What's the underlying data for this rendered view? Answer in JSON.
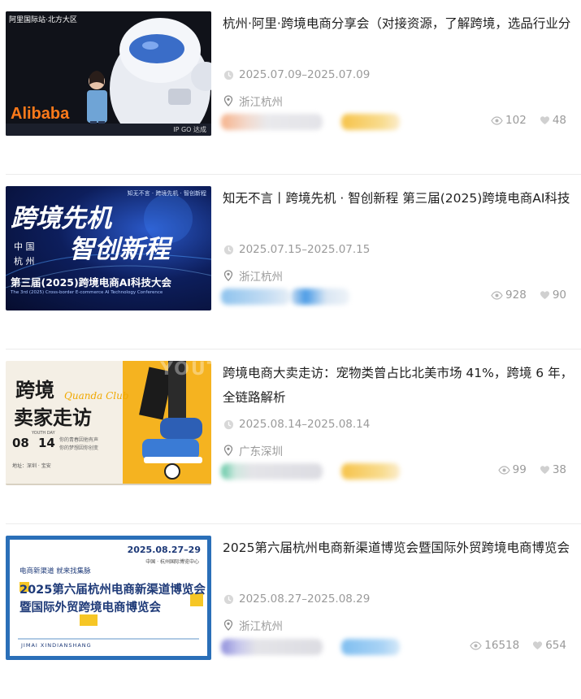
{
  "events": [
    {
      "title": "杭州·阿里·跨境电商分享会（对接资源，了解跨境，选品行业分",
      "date": "2025.07.09–2025.07.09",
      "location": "浙江杭州",
      "views": "102",
      "likes": "48",
      "thumb": {
        "top_text": "阿里国际站·北方大区",
        "brand": "Alibaba",
        "badge": "IP GO 达成"
      },
      "blur_colors": [
        "#f6b38c",
        "#f6c34a"
      ]
    },
    {
      "title": "知无不言丨跨境先机 · 智创新程 第三届(2025)跨境电商AI科技",
      "date": "2025.07.15–2025.07.15",
      "location": "浙江杭州",
      "views": "928",
      "likes": "90",
      "thumb": {
        "logos": "知无不言 · 跨境先机 · 智创新程",
        "line1": "跨境先机",
        "line2": "智创新程",
        "city1": "中 国",
        "city2": "杭 州",
        "subtitle": "第三届(2025)跨境电商AI科技大会",
        "english": "The 3rd (2025) Cross-border E-commerce AI Technology Conference"
      },
      "blur_colors": [
        "#8ec3ee",
        "#4a9be6"
      ]
    },
    {
      "title": "跨境电商大卖走访：宠物类曾占比北美市场 41%，跨境 6 年，全链路解析",
      "date": "2025.08.14–2025.08.14",
      "location": "广东深圳",
      "views": "99",
      "likes": "38",
      "thumb": {
        "line1": "跨境",
        "line2": "卖家走访",
        "club": "Quanda Club",
        "date_m": "08",
        "date_d": "14",
        "youth": "YOUTH DAY",
        "note1": "你的青春因他有声",
        "note2": "你的梦想因你创变",
        "addr": "地址：深圳 · 宝安",
        "side": "YOUTH"
      },
      "blur_colors": [
        "#5fc7a3",
        "#f6c34a"
      ]
    },
    {
      "title": "2025第六届杭州电商新渠道博览会暨国际外贸跨境电商博览会",
      "date": "2025.08.27–2025.08.29",
      "location": "浙江杭州",
      "views": "16518",
      "likes": "654",
      "thumb": {
        "date": "2025.08.27–29",
        "venue": "中国 · 杭州国际博览中心",
        "tagline": "电商新渠道  就来找集脉",
        "line1": "2025第六届杭州电商新渠道博览会",
        "line2": "暨国际外贸跨境电商博览会",
        "footer": "JIMAI XINDIANSHANG"
      },
      "blur_colors": [
        "#8f8fdc",
        "#7fbef0"
      ]
    }
  ],
  "icons": {
    "clock": "clock-icon",
    "location": "location-pin-icon",
    "eye": "eye-icon",
    "heart": "heart-icon"
  }
}
